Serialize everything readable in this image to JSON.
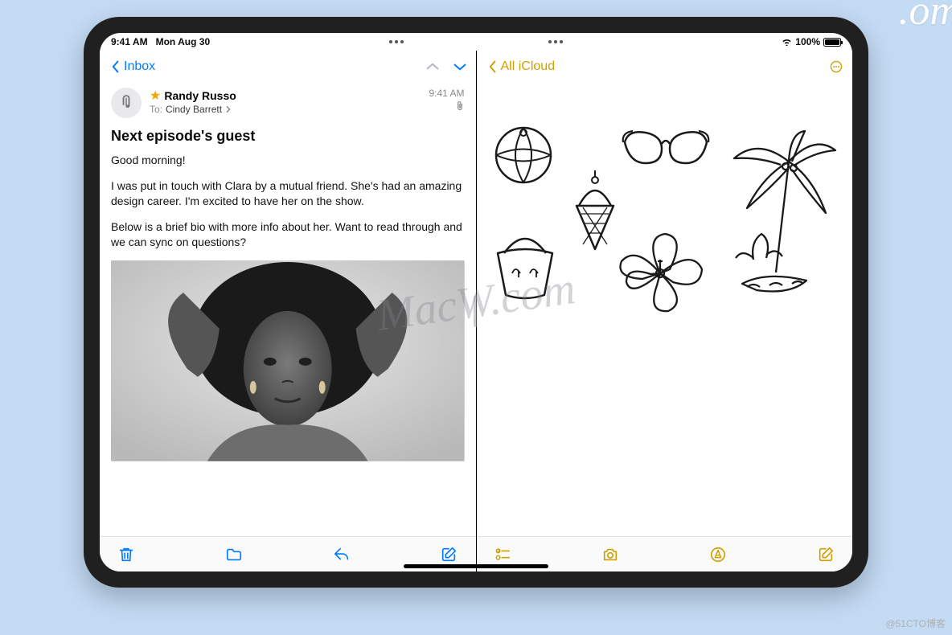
{
  "status": {
    "time": "9:41 AM",
    "date": "Mon Aug 30",
    "battery_pct": "100%"
  },
  "mail": {
    "back_label": "Inbox",
    "sender": "Randy Russo",
    "to_label": "To:",
    "recipient": "Cindy Barrett",
    "time": "9:41 AM",
    "subject": "Next episode's guest",
    "p1": "Good morning!",
    "p2": "I was put in touch with Clara by a mutual friend. She's had an amazing design career. I'm excited to have her on the show.",
    "p3": "Below is a brief bio with more info about her. Want to read through and we can sync on questions?",
    "icons": {
      "trash": "trash-icon",
      "folder": "folder-icon",
      "reply": "reply-icon",
      "compose": "compose-icon",
      "up": "chevron-up-icon",
      "down": "chevron-down-icon",
      "back": "chevron-left-icon",
      "clip": "paperclip-icon",
      "star": "star-icon"
    }
  },
  "notes": {
    "back_label": "All iCloud",
    "icons": {
      "more": "more-icon",
      "checklist": "checklist-icon",
      "camera": "camera-icon",
      "markup": "markup-icon",
      "compose": "compose-icon",
      "back": "chevron-left-icon"
    },
    "sketches": [
      "beachball",
      "sunglasses",
      "icecream",
      "bucket",
      "hibiscus",
      "palm"
    ]
  },
  "watermarks": {
    "center": "MacW.com",
    "corner": ".om",
    "blog": "@51CTO博客"
  },
  "colors": {
    "ios_blue": "#007aff",
    "notes_yellow": "#cda100",
    "page_bg": "#c4dbf4"
  }
}
